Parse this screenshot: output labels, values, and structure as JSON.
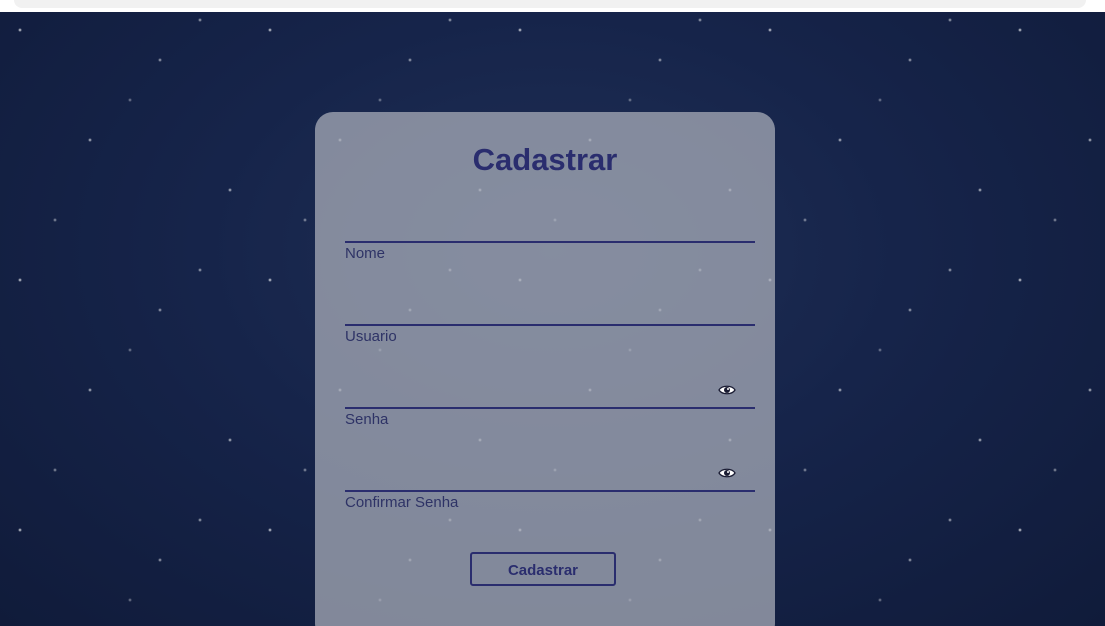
{
  "form": {
    "title": "Cadastrar",
    "fields": [
      {
        "label": "Nome",
        "value": ""
      },
      {
        "label": "Usuario",
        "value": ""
      },
      {
        "label": "Senha",
        "value": ""
      },
      {
        "label": "Confirmar Senha",
        "value": ""
      }
    ],
    "submit_label": "Cadastrar"
  },
  "icons": {
    "show_password": "eye-icon"
  },
  "colors": {
    "accent": "#2a2d6e",
    "card": "#adb2bc"
  }
}
